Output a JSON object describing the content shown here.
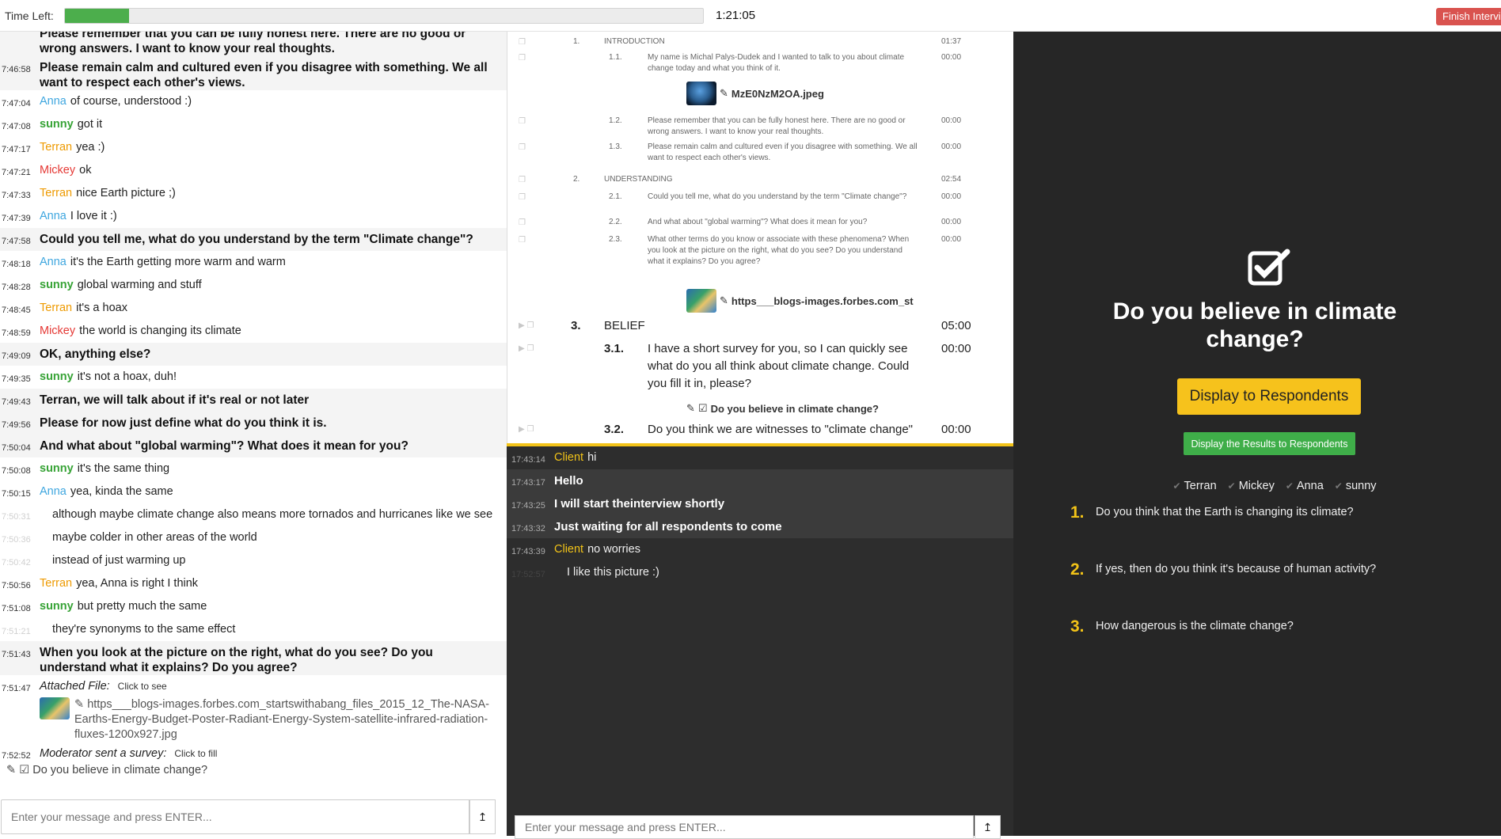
{
  "topbar": {
    "time_left_label": "Time Left:",
    "progress": 0.1,
    "time": "1:21:05",
    "finish_label": "Finish Interview"
  },
  "left_chat": {
    "messages": [
      {
        "ts": "",
        "type": "mod",
        "user": "",
        "text": "Please remember that you can be fully honest here. There are no good or wrong answers. I want to know your real thoughts."
      },
      {
        "ts": "7:46:58",
        "type": "mod",
        "user": "",
        "text": "Please remain calm and cultured even if you disagree with something. We all want to respect each other's views."
      },
      {
        "ts": "7:47:04",
        "type": "resp",
        "user": "Anna",
        "text": "of course, understood :)"
      },
      {
        "ts": "7:47:08",
        "type": "resp",
        "user": "sunny",
        "text": "got it"
      },
      {
        "ts": "7:47:17",
        "type": "resp",
        "user": "Terran",
        "text": "yea :)"
      },
      {
        "ts": "7:47:21",
        "type": "resp",
        "user": "Mickey",
        "text": "ok"
      },
      {
        "ts": "7:47:33",
        "type": "resp",
        "user": "Terran",
        "text": "nice Earth picture ;)"
      },
      {
        "ts": "7:47:39",
        "type": "resp",
        "user": "Anna",
        "text": "I love it :)"
      },
      {
        "ts": "7:47:58",
        "type": "mod",
        "user": "",
        "text": "Could you tell me, what do you understand by the term \"Climate change\"?"
      },
      {
        "ts": "7:48:18",
        "type": "resp",
        "user": "Anna",
        "text": "it's the Earth getting more warm and warm"
      },
      {
        "ts": "7:48:28",
        "type": "resp",
        "user": "sunny",
        "text": "global warming and stuff"
      },
      {
        "ts": "7:48:45",
        "type": "resp",
        "user": "Terran",
        "text": "it's a hoax"
      },
      {
        "ts": "7:48:59",
        "type": "resp",
        "user": "Mickey",
        "text": "the world is changing its climate"
      },
      {
        "ts": "7:49:09",
        "type": "mod",
        "user": "",
        "text": "OK, anything else?"
      },
      {
        "ts": "7:49:35",
        "type": "resp",
        "user": "sunny",
        "text": "it's not a hoax, duh!"
      },
      {
        "ts": "7:49:43",
        "type": "mod",
        "user": "",
        "text": "Terran, we will talk about if it's real or not later"
      },
      {
        "ts": "7:49:56",
        "type": "mod",
        "user": "",
        "text": "Please for now just define what do you think it is."
      },
      {
        "ts": "7:50:04",
        "type": "mod",
        "user": "",
        "text": "And what about \"global warming\"? What does it mean for you?"
      },
      {
        "ts": "7:50:08",
        "type": "resp",
        "user": "sunny",
        "text": "it's the same thing"
      },
      {
        "ts": "7:50:15",
        "type": "resp",
        "user": "Anna",
        "text": "yea, kinda the same"
      },
      {
        "ts": "7:50:31",
        "type": "cont",
        "user": "",
        "text": "although maybe climate change also means more tornados and hurricanes like we see"
      },
      {
        "ts": "7:50:36",
        "type": "cont",
        "user": "",
        "text": "maybe colder in other areas of the world"
      },
      {
        "ts": "7:50:42",
        "type": "cont",
        "user": "",
        "text": "instead of just warming up"
      },
      {
        "ts": "7:50:56",
        "type": "resp",
        "user": "Terran",
        "text": "yea, Anna is right I think"
      },
      {
        "ts": "7:51:08",
        "type": "resp",
        "user": "sunny",
        "text": "but pretty much the same"
      },
      {
        "ts": "7:51:21",
        "type": "cont",
        "user": "",
        "text": "they're synonyms to the same effect"
      },
      {
        "ts": "7:51:43",
        "type": "mod",
        "user": "",
        "text": "When you look at the picture on the right, what do you see? Do you understand what it explains? Do you agree?"
      }
    ],
    "attached": {
      "ts": "7:51:47",
      "label": "Attached File:",
      "action": "Click to see",
      "filename": "https___blogs-images.forbes.com_startswithabang_files_2015_12_The-NASA-Earths-Energy-Budget-Poster-Radiant-Energy-System-satellite-infrared-radiation-fluxes-1200x927.jpg"
    },
    "survey_sent": {
      "ts": "7:52:52",
      "label": "Moderator sent a survey:",
      "action": "Click to fill",
      "title": "Do you believe in climate change?"
    },
    "input_placeholder": "Enter your message and press ENTER...",
    "send_icon": "upload-arrow-icon"
  },
  "guide": {
    "rows": [
      {
        "num": "1.",
        "text": "INTRODUCTION",
        "dur": "01:37",
        "level": "section",
        "size": "small"
      },
      {
        "num": "1.1.",
        "text": "My name is Michal Palys-Dudek and I wanted to talk to you about climate change today and what you think of it.",
        "dur": "00:00",
        "level": "item",
        "size": "small"
      },
      {
        "num": "1.2.",
        "text": "Please remember that you can be fully honest here. There are no good or wrong answers. I want to know your real thoughts.",
        "dur": "00:00",
        "level": "item",
        "size": "small"
      },
      {
        "num": "1.3.",
        "text": "Please remain calm and cultured even if you disagree with something. We all want to respect each other's views.",
        "dur": "00:00",
        "level": "item",
        "size": "small"
      },
      {
        "num": "2.",
        "text": "UNDERSTANDING",
        "dur": "02:54",
        "level": "section",
        "size": "small"
      },
      {
        "num": "2.1.",
        "text": "Could you tell me, what do you understand by the term \"Climate change\"?",
        "dur": "00:00",
        "level": "item",
        "size": "small"
      },
      {
        "num": "2.2.",
        "text": "And what about \"global warming\"? What does it mean for you?",
        "dur": "00:00",
        "level": "item",
        "size": "small"
      },
      {
        "num": "2.3.",
        "text": "What other terms do you know or associate with these phenomena? When you look at the picture on the right, what do you see? Do you understand what it explains? Do you agree?",
        "dur": "00:00",
        "level": "item",
        "size": "small"
      },
      {
        "num": "3.",
        "text": "BELIEF",
        "dur": "05:00",
        "level": "section",
        "size": "big"
      },
      {
        "num": "3.1.",
        "text": "I have a short survey for you, so I can quickly see what do you all think about climate change. Could you fill it in, please?",
        "dur": "00:00",
        "level": "item",
        "size": "big"
      },
      {
        "num": "3.2.",
        "text": "Do you think we are witnesses to \"climate change\"",
        "dur": "00:00",
        "level": "item",
        "size": "big"
      }
    ],
    "attach_1": "MzE0NzM2OA.jpeg",
    "attach_2": "https___blogs-images.forbes.com_st",
    "survey_attach": "Do you believe in climate change?"
  },
  "mid_chat": {
    "messages": [
      {
        "ts": "17:43:14",
        "type": "resp",
        "user": "Client",
        "text": "hi"
      },
      {
        "ts": "17:43:17",
        "type": "mod",
        "user": "",
        "text": "Hello"
      },
      {
        "ts": "17:43:25",
        "type": "mod",
        "user": "",
        "text": "I will start theinterview shortly"
      },
      {
        "ts": "17:43:32",
        "type": "mod",
        "user": "",
        "text": "Just waiting for all respondents to come"
      },
      {
        "ts": "17:43:39",
        "type": "resp",
        "user": "Client",
        "text": "no worries"
      },
      {
        "ts": "17:52:57",
        "type": "cont",
        "user": "",
        "text": "I like this picture :)"
      }
    ],
    "input_placeholder": "Enter your message and press ENTER..."
  },
  "survey": {
    "icon": "checkbox-checked-icon",
    "title": "Do you believe in climate change?",
    "display_button": "Display to Respondents",
    "results_button": "Display the Results to Respondents",
    "respondents": [
      "Terran",
      "Mickey",
      "Anna",
      "sunny"
    ],
    "questions": [
      {
        "n": "1.",
        "text": "Do you think that the Earth is changing its climate?"
      },
      {
        "n": "2.",
        "text": "If yes, then do you think it's because of human activity?"
      },
      {
        "n": "3.",
        "text": "How dangerous is the climate change?"
      }
    ]
  },
  "colors": {
    "anna": "#3ea6df",
    "sunny": "#37a336",
    "terran": "#ee9a00",
    "mickey": "#e53935",
    "client": "#f2c318",
    "accent_yellow": "#f6c21c",
    "accent_green": "#3fae49",
    "finish_red": "#d9534f"
  }
}
